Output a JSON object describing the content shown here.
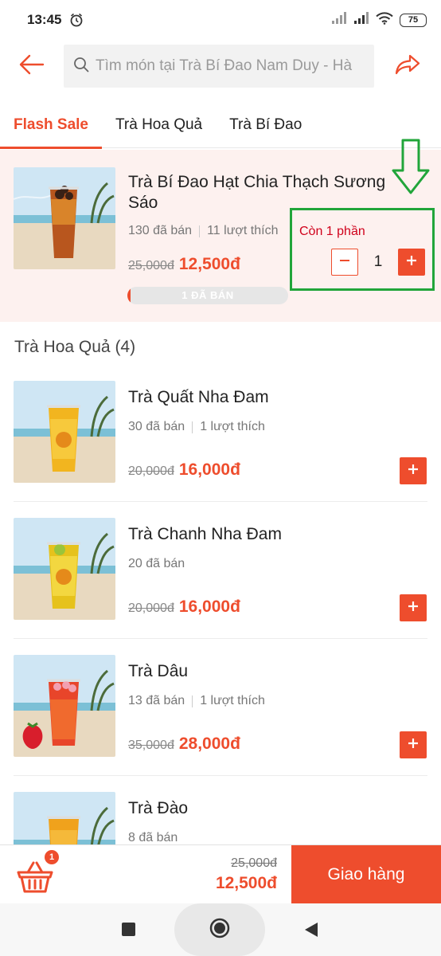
{
  "status_bar": {
    "time": "13:45",
    "battery": "75"
  },
  "header": {
    "search_placeholder": "Tìm món tại Trà Bí Đao Nam Duy - Hà"
  },
  "tabs": [
    {
      "label": "Flash Sale",
      "active": true
    },
    {
      "label": "Trà Hoa Quả",
      "active": false
    },
    {
      "label": "Trà Bí Đao",
      "active": false
    }
  ],
  "flash_sale": {
    "name": "Trà Bí Đao Hạt Chia Thạch Sương Sáo",
    "sold": "130 đã bán",
    "likes": "11 lượt thích",
    "old_price": "25,000đ",
    "price": "12,500đ",
    "remaining": "Còn 1 phần",
    "quantity": "1",
    "sold_label": "1 ĐÃ BÁN",
    "sold_progress": 0.02
  },
  "section": {
    "title": "Trà Hoa Quả (4)"
  },
  "products": [
    {
      "name": "Trà Quất Nha Đam",
      "sold": "30 đã bán",
      "likes": "1 lượt thích",
      "old_price": "20,000đ",
      "price": "16,000đ"
    },
    {
      "name": "Trà Chanh Nha Đam",
      "sold": "20 đã bán",
      "likes": "",
      "old_price": "20,000đ",
      "price": "16,000đ"
    },
    {
      "name": "Trà Dâu",
      "sold": "13 đã bán",
      "likes": "1 lượt thích",
      "old_price": "35,000đ",
      "price": "28,000đ"
    },
    {
      "name": "Trà Đào",
      "sold": "8 đã bán",
      "likes": "",
      "old_price": "",
      "price": ""
    }
  ],
  "cart": {
    "badge": "1",
    "total_old": "25,000đ",
    "total": "12,500đ",
    "checkout_label": "Giao hàng"
  },
  "colors": {
    "accent": "#ee4d2d",
    "annotation": "#21a53a",
    "flash_bg": "#fdf1ef"
  },
  "icons": [
    "alarm-icon",
    "signal-icon",
    "wifi-icon",
    "battery-icon",
    "back-arrow-icon",
    "search-icon",
    "share-icon",
    "minus-icon",
    "plus-icon",
    "cart-icon",
    "nav-recents-icon",
    "nav-home-icon",
    "nav-back-icon",
    "annotation-down-arrow-icon"
  ]
}
